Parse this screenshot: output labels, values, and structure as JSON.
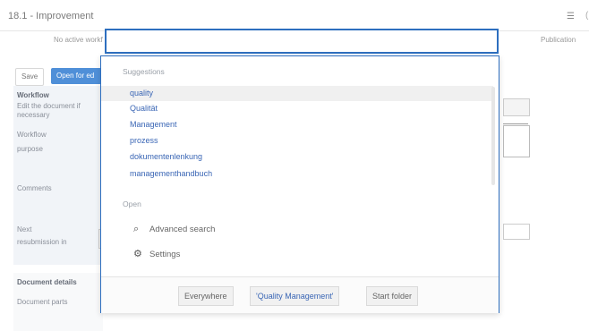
{
  "background": {
    "title": "18.1 - Improvement",
    "menu_icon": "hamburger-menu-icon",
    "edge_glyph": "(",
    "subtitle_left": "No active workf",
    "subtitle_right": "Publication",
    "tabs": {
      "save": "Save",
      "open": "Open for ed"
    },
    "workflow": {
      "section": "Workflow",
      "text": "Edit the document if",
      "text2": "necessary",
      "fields": [
        "Workflow",
        "purpose",
        "Comments",
        "Next",
        "resubmission in"
      ]
    },
    "details": {
      "section": "Document details",
      "field": "Document parts"
    }
  },
  "search": {
    "placeholder": "",
    "value": ""
  },
  "dropdown": {
    "suggestions_heading": "Suggestions",
    "suggestions": [
      "quality",
      "Qualität",
      "Management",
      "prozess",
      "dokumentenlenkung",
      "managementhandbuch"
    ],
    "active_index": 0,
    "open_heading": "Open",
    "options": [
      {
        "icon": "search-icon",
        "label": "Advanced search"
      },
      {
        "icon": "gear-icon",
        "label": "Settings"
      }
    ],
    "scopes": [
      "Everywhere",
      "'Quality Management'",
      "Start folder"
    ],
    "selected_scope": 1
  },
  "colors": {
    "accent": "#2e6fbf",
    "link": "#3a66b5",
    "tab_active": "#4f8fd8"
  }
}
